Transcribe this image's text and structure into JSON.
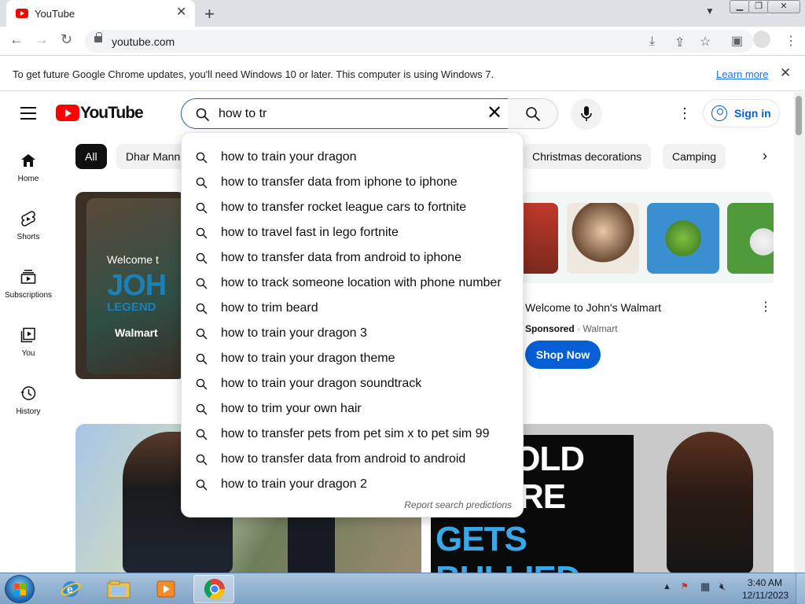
{
  "browser": {
    "tab_title": "YouTube",
    "tab_close": "✕",
    "new_tab": "+",
    "url": "youtube.com"
  },
  "infobar": {
    "message": "To get future Google Chrome updates, you'll need Windows 10 or later. This computer is using Windows 7.",
    "learn_more": "Learn more",
    "close": "✕"
  },
  "youtube": {
    "logo_text": "YouTube",
    "search_value": "how to tr",
    "sign_in": "Sign in",
    "guide": [
      {
        "label": "Home",
        "icon": "home-icon"
      },
      {
        "label": "Shorts",
        "icon": "shorts-icon"
      },
      {
        "label": "Subscriptions",
        "icon": "subscriptions-icon"
      },
      {
        "label": "You",
        "icon": "you-icon"
      },
      {
        "label": "History",
        "icon": "history-icon"
      }
    ],
    "chips": [
      "All",
      "Dhar Mann",
      "Christmas decorations",
      "Camping"
    ],
    "suggestions": [
      "how to train your dragon",
      "how to transfer data from iphone to iphone",
      "how to transfer rocket league cars to fortnite",
      "how to travel fast in lego fortnite",
      "how to transfer data from android to iphone",
      "how to track someone location with phone number",
      "how to trim beard",
      "how to train your dragon 3",
      "how to train your dragon theme",
      "how to train your dragon soundtrack",
      "how to trim your own hair",
      "how to transfer pets from pet sim x to pet sim 99",
      "how to transfer data from android to android",
      "how to train your dragon 2"
    ],
    "report_predictions": "Report search predictions",
    "ad_left": {
      "welcome": "Welcome t",
      "john": "JOH",
      "legend": "LEGEND",
      "walmart": "Walmart"
    },
    "ad": {
      "title": "Welcome to John's Walmart",
      "sponsored": "Sponsored",
      "separator": " · ",
      "advertiser": "Walmart",
      "cta": "Shop Now"
    },
    "video_right": {
      "line1": "AR-OLD",
      "line2": "ONAIRE",
      "line3": "GETS BULLIED"
    }
  },
  "taskbar": {
    "time": "3:40 AM",
    "date": "12/11/2023"
  },
  "colors": {
    "youtube_red": "#ff0000",
    "link_blue": "#065fd4",
    "chrome_tabstrip": "#dee1e6"
  }
}
